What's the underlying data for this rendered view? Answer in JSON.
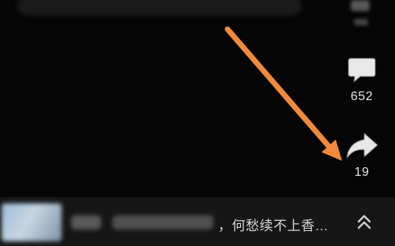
{
  "side_actions": {
    "comment_count": "652",
    "share_count": "19"
  },
  "bottom_bar": {
    "music_title": "，何愁续不上香…"
  },
  "icons": {
    "comment": "chat-bubble-icon",
    "share": "share-arrow-icon",
    "expand": "double-chevron-up-icon"
  },
  "colors": {
    "background": "#050505",
    "annotation_arrow": "#f08a3a",
    "icon": "#e8e8e8"
  }
}
